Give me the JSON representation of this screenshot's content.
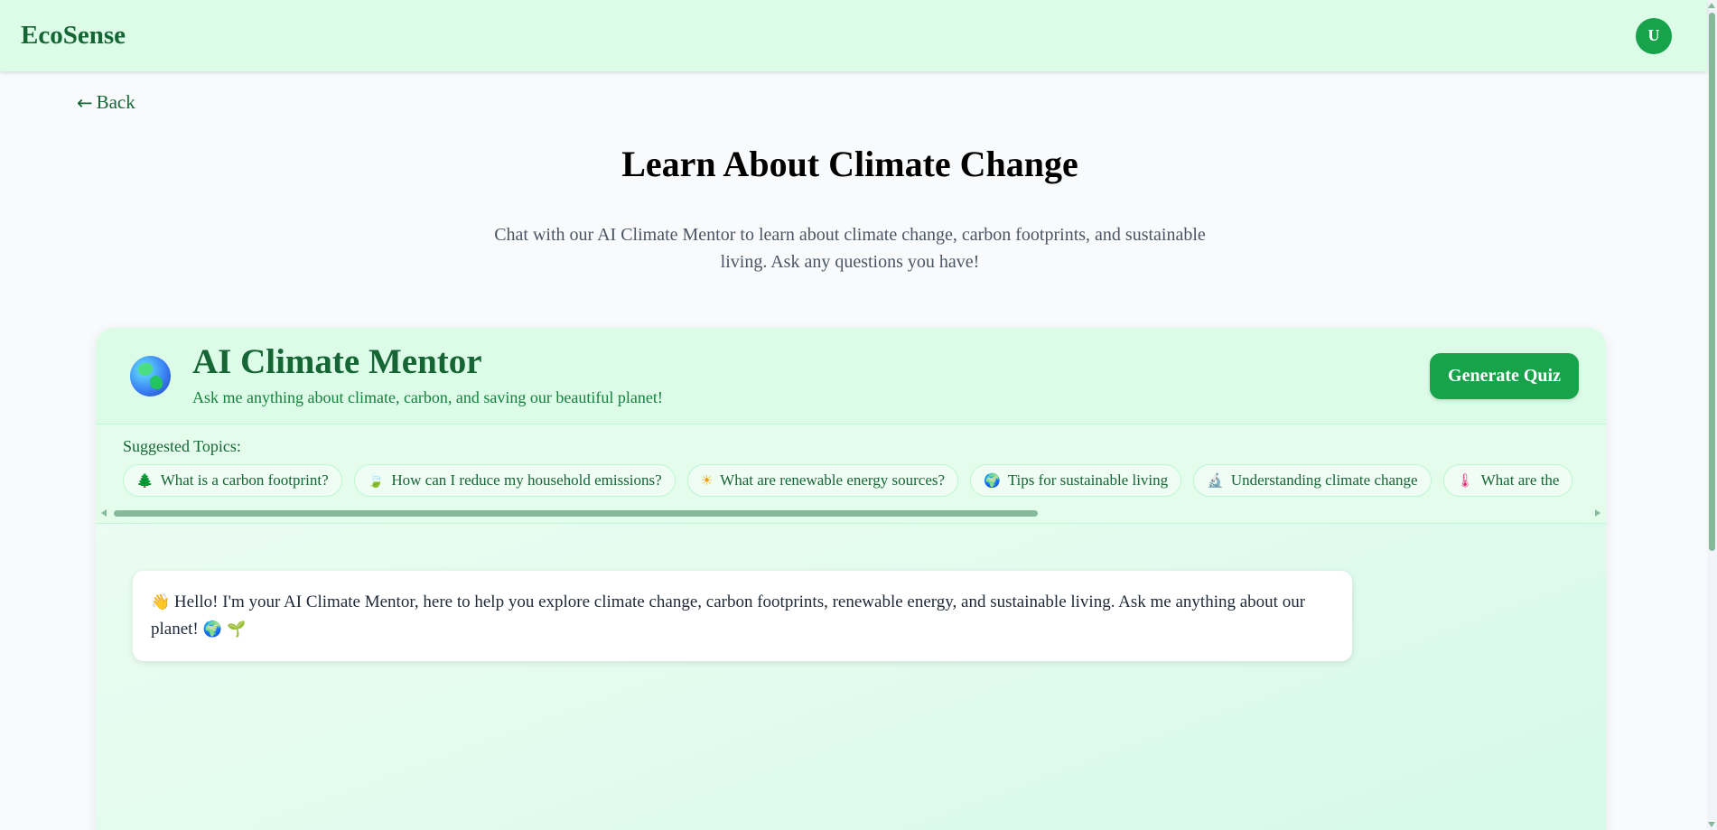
{
  "navbar": {
    "brand": "EcoSense",
    "avatar_initial": "U"
  },
  "back_link": {
    "arrow": "←",
    "label": "Back"
  },
  "page": {
    "title": "Learn About Climate Change",
    "description": "Chat with our AI Climate Mentor to learn about climate change, carbon footprints, and sustainable living. Ask any questions you have!"
  },
  "chat": {
    "icon": "globe-icon",
    "title": "AI Climate Mentor",
    "subtitle": "Ask me anything about climate, carbon, and saving our beautiful planet!",
    "quiz_button_label": "Generate Quiz",
    "topics_label": "Suggested Topics:",
    "topics": [
      {
        "emoji": "🌲",
        "icon": "tree-icon",
        "label": "What is a carbon footprint?"
      },
      {
        "emoji": "🍃",
        "icon": "leaf-icon",
        "label": "How can I reduce my household emissions?"
      },
      {
        "emoji": "☀",
        "icon": "sun-icon",
        "label": "What are renewable energy sources?"
      },
      {
        "emoji": "🌍",
        "icon": "earth-icon",
        "label": "Tips for sustainable living"
      },
      {
        "emoji": "🔬",
        "icon": "microscope-icon",
        "label": "Understanding climate change"
      },
      {
        "emoji": "🌡",
        "icon": "thermometer-icon",
        "label": "What are the"
      }
    ],
    "welcome_message": {
      "wave_emoji": "👋",
      "text": "Hello! I'm your AI Climate Mentor, here to help you explore climate change, carbon footprints, renewable energy, and sustainable living. Ask me anything about our planet!",
      "trailing_emojis": "🌍 🌱"
    }
  },
  "colors": {
    "brand_green": "#166534",
    "button_green": "#16a34a",
    "header_bg": "#dcfce7"
  }
}
